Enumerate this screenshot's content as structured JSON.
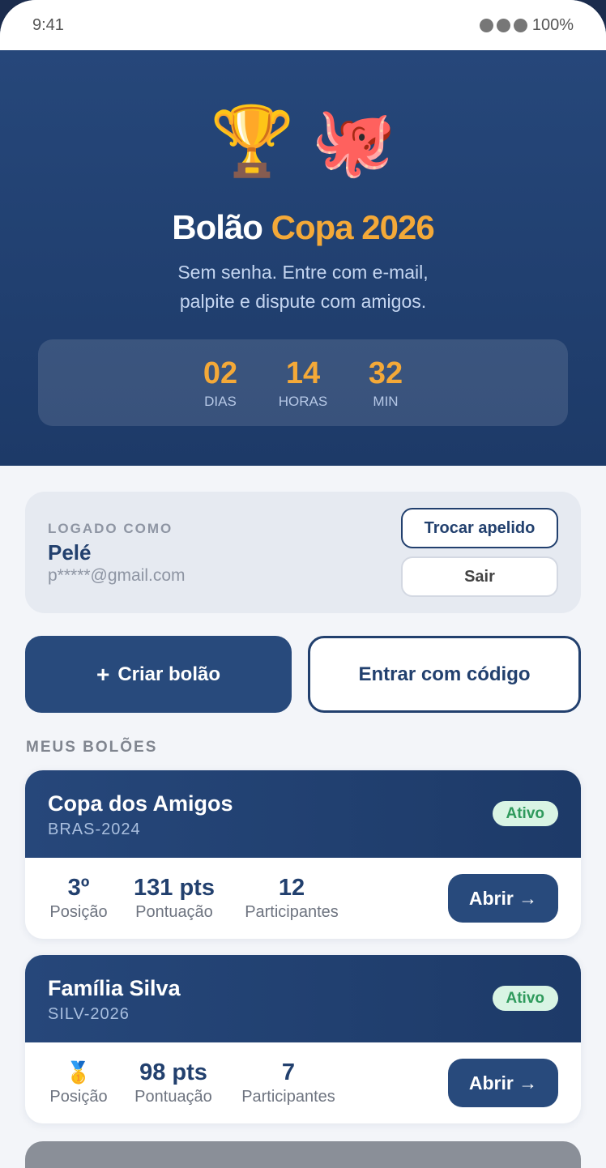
{
  "status_bar": {
    "time": "9:41",
    "battery": "100%"
  },
  "hero": {
    "emojis": [
      "🏆",
      "🐙"
    ],
    "title_main": "Bolão",
    "title_accent": "Copa 2026",
    "subtitle_line1": "Sem senha. Entre com e-mail,",
    "subtitle_line2": "palpite e dispute com amigos."
  },
  "countdown": [
    {
      "value": "02",
      "label": "DIAS"
    },
    {
      "value": "14",
      "label": "HORAS"
    },
    {
      "value": "32",
      "label": "MIN"
    }
  ],
  "user": {
    "label": "LOGADO COMO",
    "name": "Pelé",
    "email": "p*****@gmail.com",
    "change_nick_label": "Trocar apelido",
    "logout_label": "Sair"
  },
  "actions": {
    "create_icon": "+",
    "create_label": "Criar bolão",
    "join_label": "Entrar com código"
  },
  "section_title": "MEUS BOLÕES",
  "pools": [
    {
      "name": "Copa dos Amigos",
      "code": "BRAS-2024",
      "status": "Ativo",
      "position": "3º",
      "position_label": "Posição",
      "score": "131 pts",
      "score_label": "Pontuação",
      "participants": "12",
      "participants_label": "Participantes",
      "open_label": "Abrir →"
    },
    {
      "name": "Família Silva",
      "code": "SILV-2026",
      "status": "Ativo",
      "position_icon": "🥇",
      "position_label": "Posição",
      "score": "98 pts",
      "score_label": "Pontuação",
      "participants": "7",
      "participants_label": "Participantes",
      "open_label": "Abrir →"
    }
  ],
  "colors": {
    "primary": "#22406e",
    "accent": "#f4a938",
    "success_bg": "#d9f4e4",
    "success_text": "#2f9a5c"
  }
}
